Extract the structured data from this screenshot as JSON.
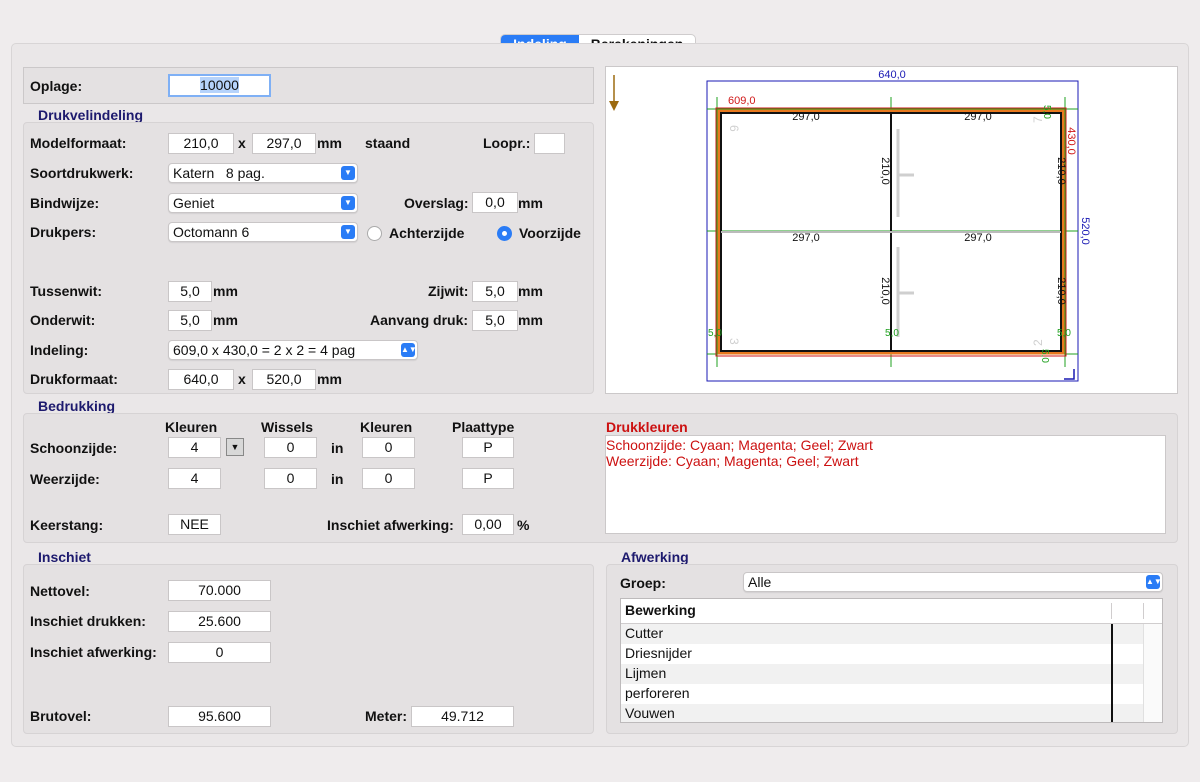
{
  "tabs": [
    {
      "label": "Indeling",
      "active": true
    },
    {
      "label": "Berekeningen",
      "active": false
    }
  ],
  "oplage": {
    "label": "Oplage:",
    "value": "10000"
  },
  "drukvelindeling": {
    "title": "Drukvelindeling",
    "modelformaat": {
      "label": "Modelformaat:",
      "width": "210,0",
      "x": "x",
      "height": "297,0",
      "unit": "mm",
      "orientation": "staand"
    },
    "loopr": {
      "label": "Loopr.:",
      "value": ""
    },
    "soortdrukwerk": {
      "label": "Soortdrukwerk:",
      "value": "Katern   8 pag."
    },
    "bindwijze": {
      "label": "Bindwijze:",
      "value": "Geniet"
    },
    "overslag": {
      "label": "Overslag:",
      "value": "0,0",
      "unit": "mm"
    },
    "drukpers": {
      "label": "Drukpers:",
      "value": "Octomann 6"
    },
    "achterzijde": {
      "label": "Achterzijde",
      "selected": false
    },
    "voorzijde": {
      "label": "Voorzijde",
      "selected": true
    },
    "tussenwit": {
      "label": "Tussenwit:",
      "value": "5,0",
      "unit": "mm"
    },
    "zijwit": {
      "label": "Zijwit:",
      "value": "5,0",
      "unit": "mm"
    },
    "onderwit": {
      "label": "Onderwit:",
      "value": "5,0",
      "unit": "mm"
    },
    "aanvang_druk": {
      "label": "Aanvang druk:",
      "value": "5,0",
      "unit": "mm"
    },
    "indeling": {
      "label": "Indeling:",
      "value": "609,0 x 430,0 = 2 x 2 = 4 pag"
    },
    "drukformaat": {
      "label": "Drukformaat:",
      "width": "640,0",
      "x": "x",
      "height": "520,0",
      "unit": "mm"
    }
  },
  "preview": {
    "sheet_width": "640,0",
    "sheet_height": "520,0",
    "layout_width": "609,0",
    "layout_height": "430,0",
    "page_width": "297,0",
    "page_height": "210,0",
    "margin": "5,0",
    "page_numbers": [
      "6",
      "7",
      "3",
      "2"
    ],
    "colors": {
      "sheet": "#1a1ab4",
      "layout": "#d01818",
      "margin": "#1fa01f",
      "orange": "#e8781e",
      "arrow": "#9c6a10"
    }
  },
  "bedrukking": {
    "title": "Bedrukking",
    "headers": {
      "kleuren1": "Kleuren",
      "wissels": "Wissels",
      "kleuren2": "Kleuren",
      "plaattype": "Plaattype"
    },
    "schoonzijde": {
      "label": "Schoonzijde:",
      "kleuren": "4",
      "wissels": "0",
      "in": "in",
      "kleuren2": "0",
      "plaattype": "P"
    },
    "weerzijde": {
      "label": "Weerzijde:",
      "kleuren": "4",
      "wissels": "0",
      "in": "in",
      "kleuren2": "0",
      "plaattype": "P"
    },
    "keerstang": {
      "label": "Keerstang:",
      "value": "NEE"
    },
    "inschiet_afwerking": {
      "label": "Inschiet afwerking:",
      "value": "0,00",
      "unit": "%"
    }
  },
  "drukkleuren": {
    "title": "Drukkleuren",
    "lines": [
      "Schoonzijde: Cyaan; Magenta; Geel; Zwart",
      "Weerzijde: Cyaan; Magenta; Geel; Zwart"
    ]
  },
  "inschiet": {
    "title": "Inschiet",
    "nettovel": {
      "label": "Nettovel:",
      "value": "70.000"
    },
    "inschiet_drukken": {
      "label": "Inschiet drukken:",
      "value": "25.600"
    },
    "inschiet_afwerking": {
      "label": "Inschiet afwerking:",
      "value": "0"
    },
    "brutovel": {
      "label": "Brutovel:",
      "value": "95.600"
    },
    "meter": {
      "label": "Meter:",
      "value": "49.712"
    }
  },
  "afwerking": {
    "title": "Afwerking",
    "groep": {
      "label": "Groep:",
      "value": "Alle"
    },
    "table_header": "Bewerking",
    "items": [
      "Cutter",
      "Driesnijder",
      "Lijmen",
      "perforeren",
      "Vouwen"
    ]
  },
  "colors": {
    "accent": "#2a7cf6",
    "section_title": "#1d1a6e",
    "drukkleuren_text": "#cc1111"
  }
}
